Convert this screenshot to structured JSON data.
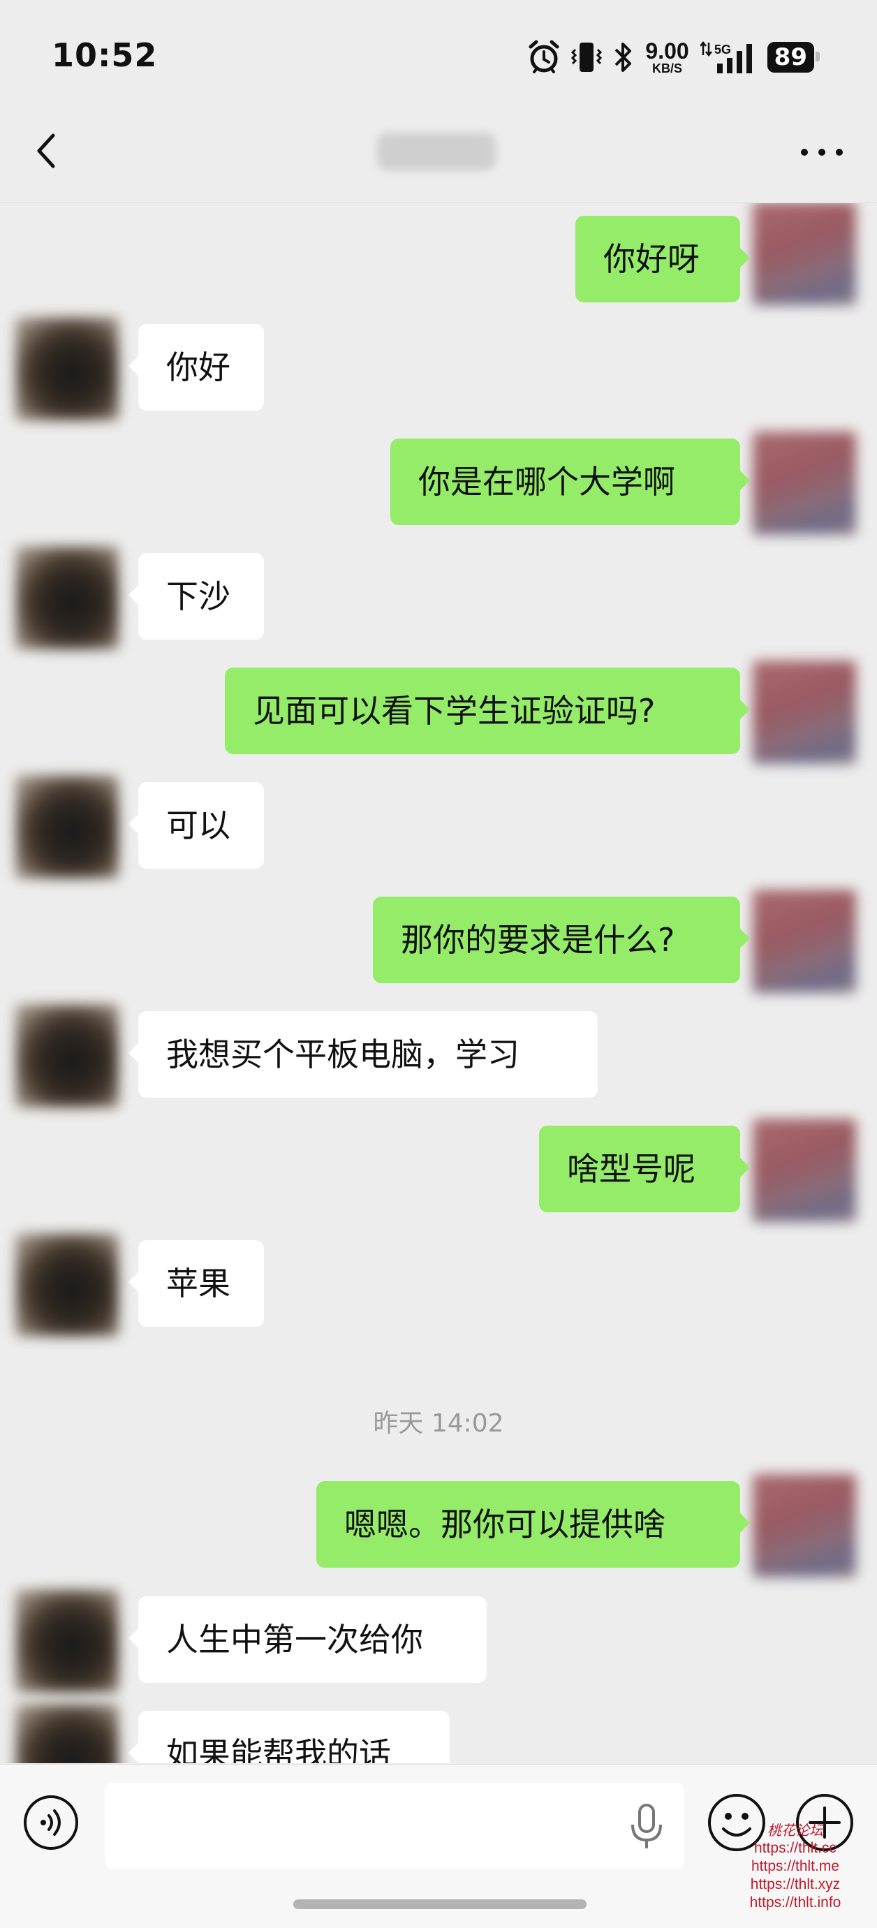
{
  "status_bar": {
    "time": "10:52",
    "net_speed_value": "9.00",
    "net_speed_unit": "KB/S",
    "network_label": "5G",
    "battery": "89",
    "icons": [
      "alarm-icon",
      "vibrate-icon",
      "bluetooth-icon",
      "net-speed",
      "signal-icon",
      "battery-icon"
    ]
  },
  "nav": {
    "back_icon": "chevron-left-icon",
    "more_icon": "more-icon"
  },
  "messages": [
    {
      "side": "right",
      "text": "你好呀"
    },
    {
      "side": "left",
      "text": "你好"
    },
    {
      "side": "right",
      "text": "你是在哪个大学啊"
    },
    {
      "side": "left",
      "text": "下沙"
    },
    {
      "side": "right",
      "text": "见面可以看下学生证验证吗?"
    },
    {
      "side": "left",
      "text": "可以"
    },
    {
      "side": "right",
      "text": "那你的要求是什么?"
    },
    {
      "side": "left",
      "text": "我想买个平板电脑，学习"
    },
    {
      "side": "right",
      "text": "啥型号呢"
    },
    {
      "side": "left",
      "text": "苹果"
    },
    {
      "side": "right",
      "text": "嗯嗯。那你可以提供啥"
    },
    {
      "side": "left",
      "text": "人生中第一次给你"
    },
    {
      "side": "left",
      "text": "如果能帮我的话"
    }
  ],
  "timestamp": "昨天 14:02",
  "input_bar": {
    "placeholder": "",
    "icons": [
      "voice-icon",
      "mic-icon",
      "emoji-icon",
      "plus-icon"
    ]
  },
  "watermark": {
    "title": "桃花论坛",
    "links": [
      "https://thlt.cc",
      "https://thlt.me",
      "https://thlt.xyz",
      "https://thlt.info"
    ]
  },
  "colors": {
    "background": "#ededed",
    "outgoing_bubble": "#95ec69",
    "incoming_bubble": "#ffffff",
    "watermark": "#c0192b"
  }
}
